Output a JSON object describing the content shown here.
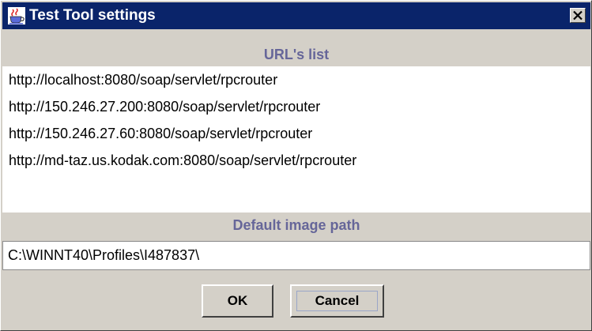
{
  "window": {
    "title": "Test Tool settings",
    "icon": "java-cup-icon",
    "close_icon": "close-icon"
  },
  "urls_section": {
    "header": "URL's list",
    "items": [
      "http://localhost:8080/soap/servlet/rpcrouter",
      "http://150.246.27.200:8080/soap/servlet/rpcrouter",
      "http://150.246.27.60:8080/soap/servlet/rpcrouter",
      "http://md-taz.us.kodak.com:8080/soap/servlet/rpcrouter"
    ]
  },
  "image_section": {
    "header": "Default image path",
    "path_value": "C:\\WINNT40\\Profiles\\I487837\\"
  },
  "buttons": {
    "ok_label": "OK",
    "cancel_label": "Cancel"
  },
  "colors": {
    "titlebar": "#0a246a",
    "section_header": "#666699",
    "dialog_bg": "#d4d0c8"
  }
}
